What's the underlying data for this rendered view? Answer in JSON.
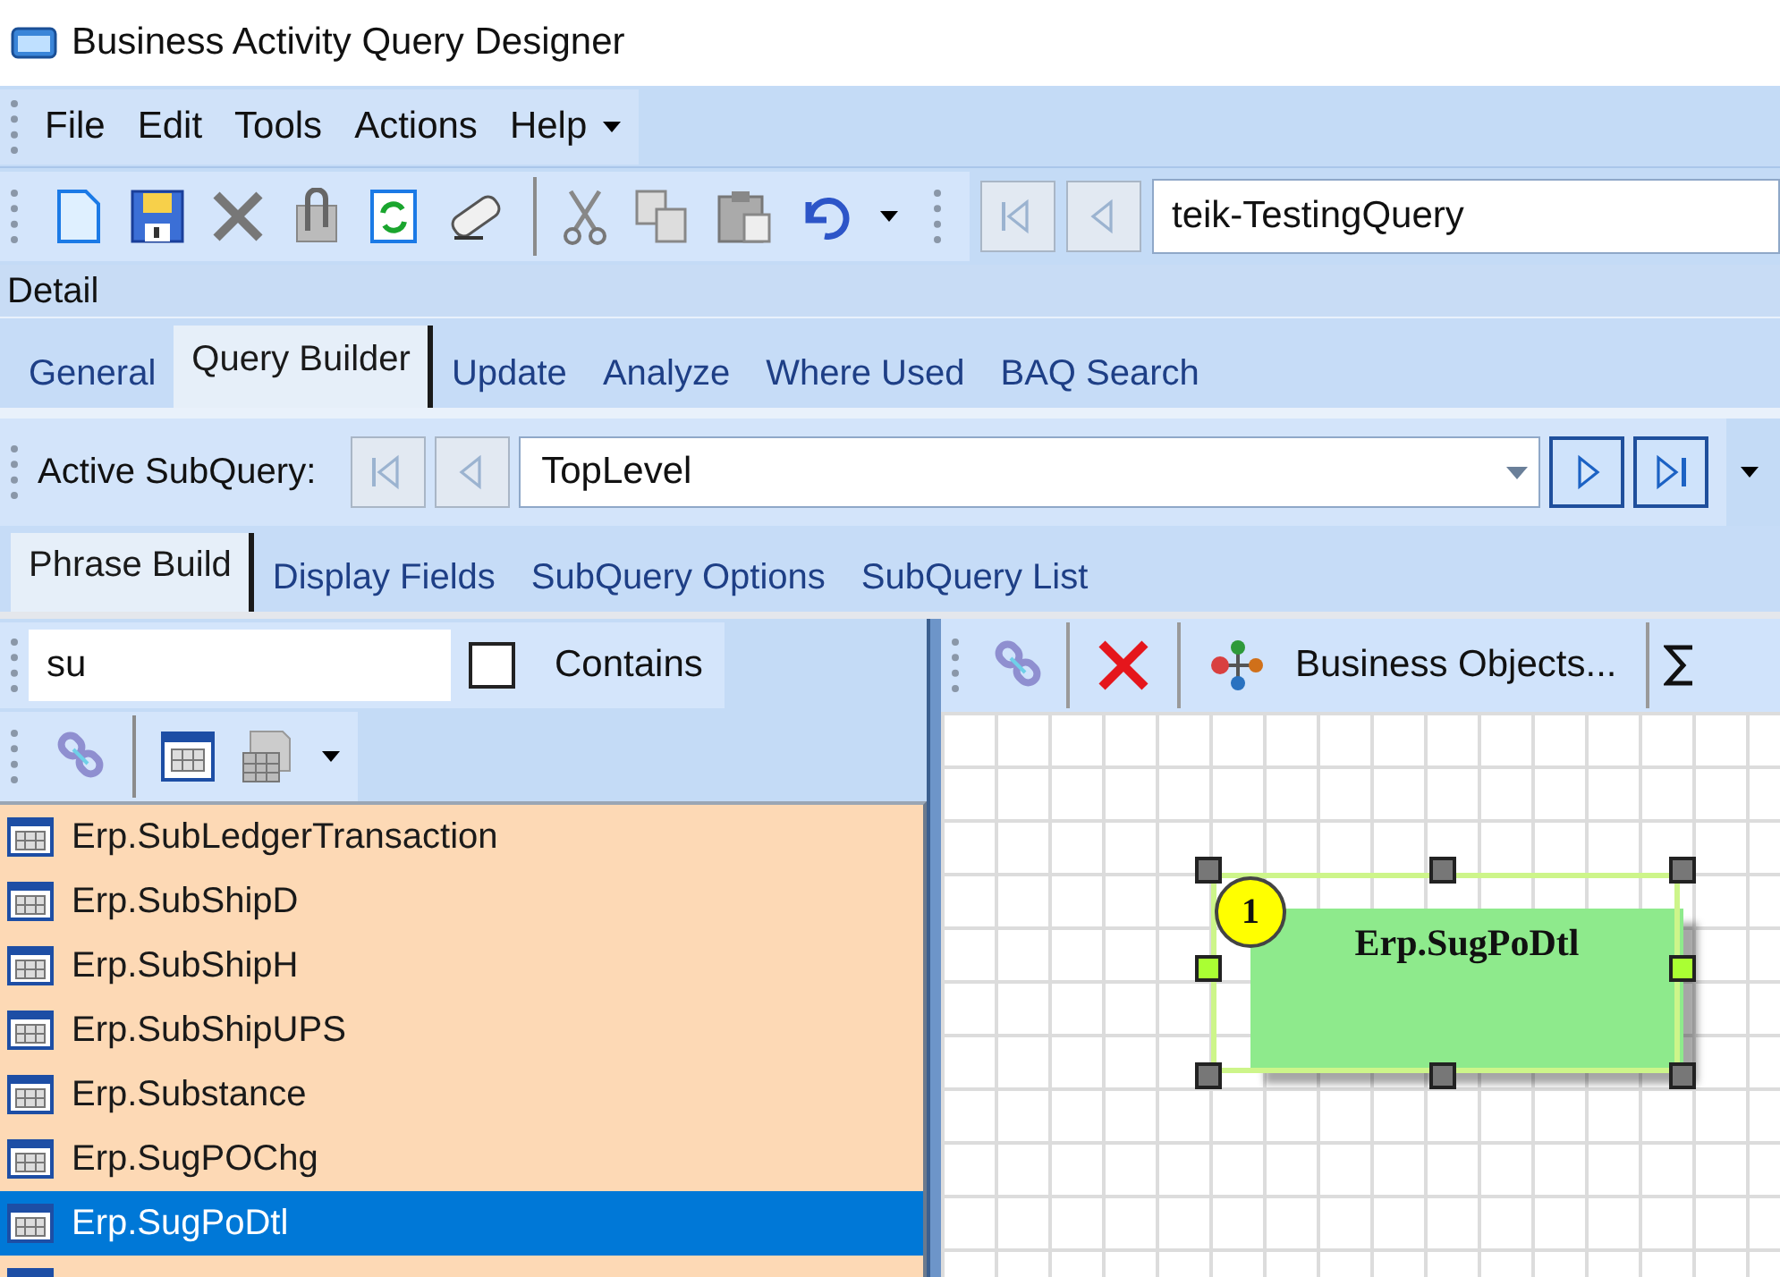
{
  "window": {
    "title": "Business Activity Query Designer"
  },
  "menu": [
    "File",
    "Edit",
    "Tools",
    "Actions",
    "Help"
  ],
  "toolbar": {
    "nav": [
      {
        "kind": "first",
        "disabled": true
      },
      {
        "kind": "prev",
        "disabled": true
      }
    ],
    "query_field": "teik-TestingQuery"
  },
  "section_label": "Detail",
  "tabs": [
    {
      "label": "General",
      "selected": false
    },
    {
      "label": "Query Builder",
      "selected": true
    },
    {
      "label": "Update",
      "selected": false
    },
    {
      "label": "Analyze",
      "selected": false
    },
    {
      "label": "Where Used",
      "selected": false
    },
    {
      "label": "BAQ Search",
      "selected": false
    }
  ],
  "subquery_bar": {
    "label": "Active SubQuery:",
    "value": "TopLevel",
    "nav": [
      {
        "kind": "first",
        "disabled": true
      },
      {
        "kind": "prev",
        "disabled": true
      },
      {
        "kind": "next",
        "disabled": false
      },
      {
        "kind": "last",
        "disabled": false
      }
    ]
  },
  "subtabs": [
    {
      "label": "Phrase Build",
      "selected": true
    },
    {
      "label": "Display Fields",
      "selected": false
    },
    {
      "label": "SubQuery Options",
      "selected": false
    },
    {
      "label": "SubQuery List",
      "selected": false
    }
  ],
  "table_search": {
    "value": "su",
    "contains_checked": false,
    "contains_label": "Contains"
  },
  "tables": [
    {
      "name": "Erp.SubLedgerTransaction",
      "selected": false
    },
    {
      "name": "Erp.SubShipD",
      "selected": false
    },
    {
      "name": "Erp.SubShipH",
      "selected": false
    },
    {
      "name": "Erp.SubShipUPS",
      "selected": false
    },
    {
      "name": "Erp.Substance",
      "selected": false
    },
    {
      "name": "Erp.SugPOChg",
      "selected": false
    },
    {
      "name": "Erp.SugPoDtl",
      "selected": true
    }
  ],
  "diagram_toolbar": {
    "business_objects": "Business Objects..."
  },
  "diagram": {
    "nodes": [
      {
        "badge": "1",
        "name": "Erp.SugPoDtl",
        "selected": true
      }
    ]
  }
}
